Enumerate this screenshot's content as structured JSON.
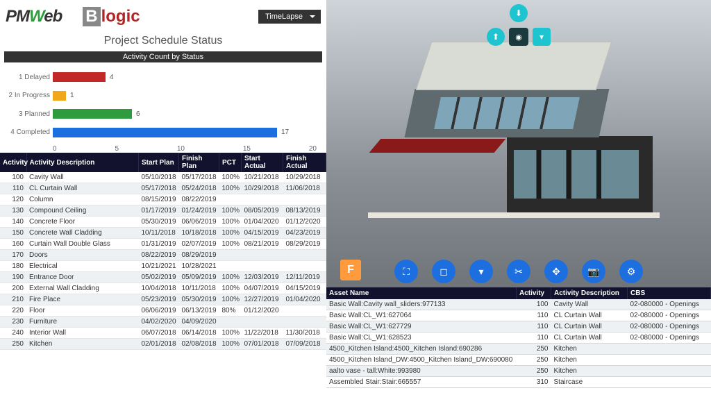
{
  "header": {
    "logo1": {
      "pm": "PM",
      "w": "W",
      "eb": "eb"
    },
    "logo2": {
      "b": "B",
      "logic": "logic"
    },
    "timelapse": "TimeLapse"
  },
  "title": "Project Schedule Status",
  "chart_data": {
    "type": "bar",
    "title": "Activity Count by Status",
    "orientation": "horizontal",
    "categories": [
      "1 Delayed",
      "2 In Progress",
      "3 Planned",
      "4 Completed"
    ],
    "values": [
      4,
      1,
      6,
      17
    ],
    "colors": [
      "#c22828",
      "#f0a81a",
      "#2e9b3f",
      "#1d6fe0"
    ],
    "xlabel": "",
    "ylabel": "",
    "xlim": [
      0,
      20
    ],
    "xticks": [
      0,
      5,
      10,
      15,
      20
    ]
  },
  "schedule": {
    "headers": [
      "Activity",
      "Activity Description",
      "Start Plan",
      "Finish Plan",
      "PCT",
      "Start Actual",
      "Finish Actual"
    ],
    "rows": [
      [
        "100",
        "Cavity Wall",
        "05/10/2018",
        "05/17/2018",
        "100%",
        "10/21/2018",
        "10/29/2018"
      ],
      [
        "110",
        "CL Curtain Wall",
        "05/17/2018",
        "05/24/2018",
        "100%",
        "10/29/2018",
        "11/06/2018"
      ],
      [
        "120",
        "Column",
        "08/15/2019",
        "08/22/2019",
        "",
        "",
        ""
      ],
      [
        "130",
        "Compound Ceiling",
        "01/17/2019",
        "01/24/2019",
        "100%",
        "08/05/2019",
        "08/13/2019"
      ],
      [
        "140",
        "Concrete Floor",
        "05/30/2019",
        "06/06/2019",
        "100%",
        "01/04/2020",
        "01/12/2020"
      ],
      [
        "150",
        "Concrete Wall Cladding",
        "10/11/2018",
        "10/18/2018",
        "100%",
        "04/15/2019",
        "04/23/2019"
      ],
      [
        "160",
        "Curtain Wall Double Glass",
        "01/31/2019",
        "02/07/2019",
        "100%",
        "08/21/2019",
        "08/29/2019"
      ],
      [
        "170",
        "Doors",
        "08/22/2019",
        "08/29/2019",
        "",
        "",
        ""
      ],
      [
        "180",
        "Electrical",
        "10/21/2021",
        "10/28/2021",
        "",
        "",
        ""
      ],
      [
        "190",
        "Entrance Door",
        "05/02/2019",
        "05/09/2019",
        "100%",
        "12/03/2019",
        "12/11/2019"
      ],
      [
        "200",
        "External Wall Cladding",
        "10/04/2018",
        "10/11/2018",
        "100%",
        "04/07/2019",
        "04/15/2019"
      ],
      [
        "210",
        "Fire Place",
        "05/23/2019",
        "05/30/2019",
        "100%",
        "12/27/2019",
        "01/04/2020"
      ],
      [
        "220",
        "Floor",
        "06/06/2019",
        "06/13/2019",
        "80%",
        "01/12/2020",
        ""
      ],
      [
        "230",
        "Furniture",
        "04/02/2020",
        "04/09/2020",
        "",
        "",
        ""
      ],
      [
        "240",
        "Interior Wall",
        "06/07/2018",
        "06/14/2018",
        "100%",
        "11/22/2018",
        "11/30/2018"
      ],
      [
        "250",
        "Kitchen",
        "02/01/2018",
        "02/08/2018",
        "100%",
        "07/01/2018",
        "07/09/2018"
      ]
    ]
  },
  "viewer_tools": {
    "top": [
      "down-arrow"
    ],
    "top2": [
      "up-arrow",
      "target",
      "funnel"
    ],
    "bottom": [
      "expand",
      "select-box",
      "filter-clear",
      "cut",
      "orbit",
      "camera",
      "gear"
    ],
    "flogo": "F"
  },
  "assets": {
    "headers": [
      "Asset Name",
      "Activity",
      "Activity Description",
      "CBS"
    ],
    "rows": [
      [
        "Basic Wall:Cavity wall_sliders:977133",
        "100",
        "Cavity Wall",
        "02-080000 - Openings"
      ],
      [
        "Basic Wall:CL_W1:627064",
        "110",
        "CL Curtain Wall",
        "02-080000 - Openings"
      ],
      [
        "Basic Wall:CL_W1:627729",
        "110",
        "CL Curtain Wall",
        "02-080000 - Openings"
      ],
      [
        "Basic Wall:CL_W1:628523",
        "110",
        "CL Curtain Wall",
        "02-080000 - Openings"
      ],
      [
        "4500_Kitchen Island:4500_Kitchen Island:690286",
        "250",
        "Kitchen",
        ""
      ],
      [
        "4500_Kitchen Island_DW:4500_Kitchen Island_DW:690080",
        "250",
        "Kitchen",
        ""
      ],
      [
        "aalto vase - tall:White:993980",
        "250",
        "Kitchen",
        ""
      ],
      [
        "Assembled Stair:Stair:665557",
        "310",
        "Staircase",
        ""
      ]
    ]
  }
}
